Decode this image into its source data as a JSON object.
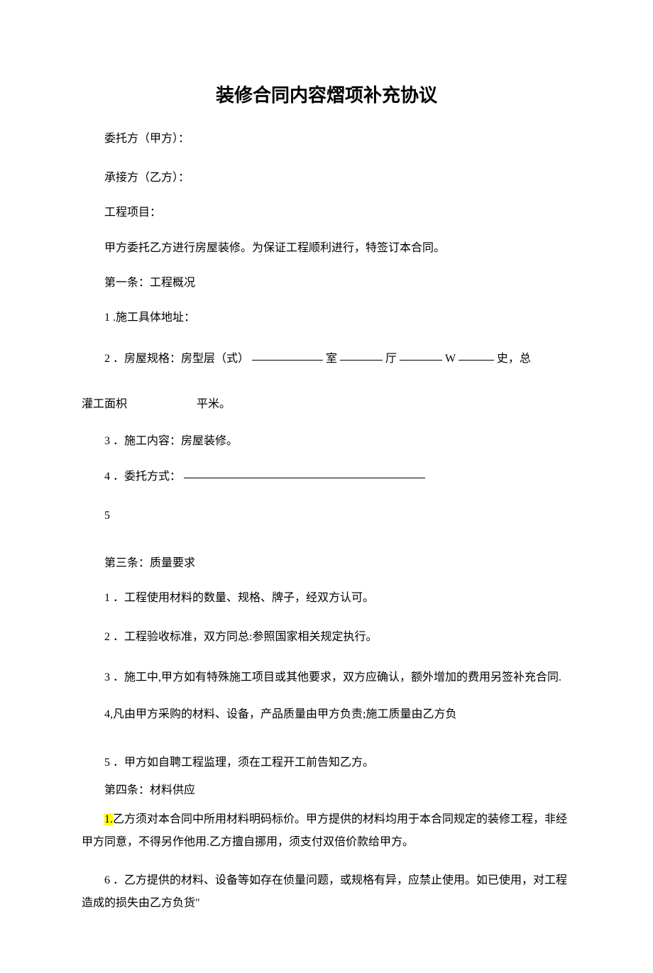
{
  "title": "装修合同内容熠项补充协议",
  "lines": {
    "party_a": "委托方（甲方）：",
    "party_b": "承接方（乙方）：",
    "project": "工程项目：",
    "intro": "甲方委托乙方进行房屋装修。为保证工程顺利进行，特签订本合同。",
    "art1_heading": "第一条：工程概况",
    "a1_1": "1 .施工具体地址：",
    "a1_2_pre": "2 ．房屋规格：房型层（式）",
    "a1_2_room": "室",
    "a1_2_ting": "厅",
    "a1_2_w": "W",
    "a1_2_shi": "史，总",
    "a1_2_cont": "灌工面枳",
    "a1_2_end": "平米。",
    "a1_3": "3 ．施工内容：房屋装修。",
    "a1_4": "4 ．委托方式：",
    "a1_5": "5",
    "art3_heading": "第三条：质量要求",
    "a3_1": "1 ．工程使用材料的数量、规格、牌子，经双方认可。",
    "a3_2": "2 ．工程验收标准，双方同总:参照国家相关规定执行。",
    "a3_3": "3 ．施工中,甲方如有特殊施工项目或其他要求，双方应确认，额外增加的费用另签补充合同.",
    "a3_4": "4,凡由甲方采购的材料、设备，产品质量由甲方负责;施工质量由乙方负",
    "a3_5": "5 ．甲方如自聘工程监理，须在工程开工前告知乙方。",
    "art4_heading": "第四条：材料供应",
    "a4_1_num": "1.",
    "a4_1_body": "乙方须对本合同中所用材料明码标价。甲方提供的材料均用于本合同规定的装修工程，非经甲方同意，不得另作他用.乙方擅自挪用，须支付双倍价款给甲方。",
    "a4_6": "6 ．乙方提供的材料、设备等如存在侦量问题，或规格有异，应禁止使用。如已使用，对工程造成的损失由乙方负货\""
  }
}
